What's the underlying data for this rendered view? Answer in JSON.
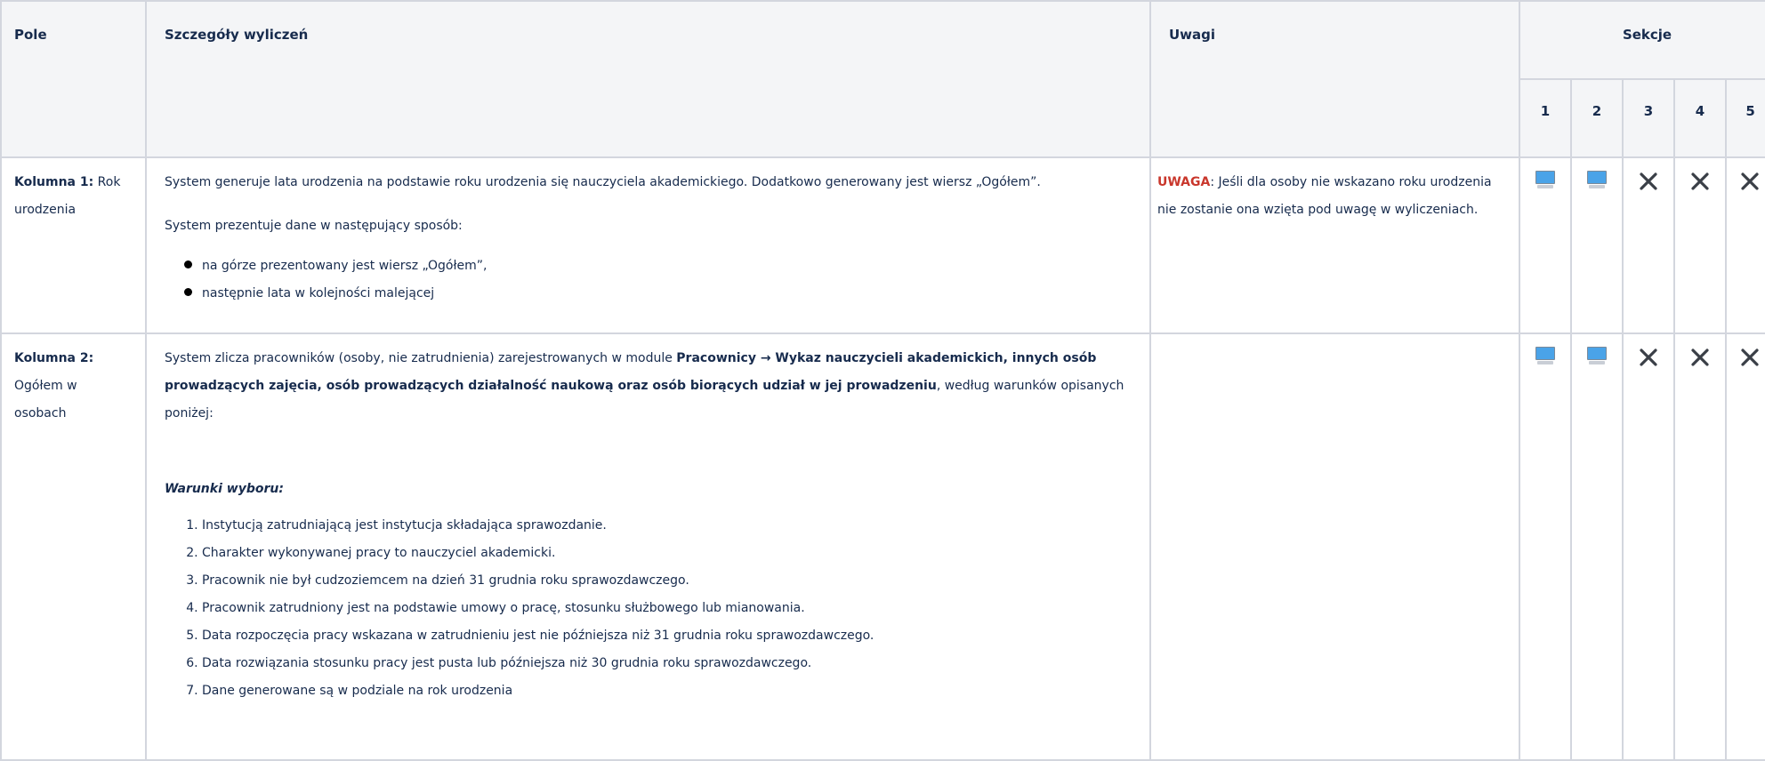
{
  "headers": {
    "pole": "Pole",
    "szczegoly": "Szczegóły wyliczeń",
    "uwagi": "Uwagi",
    "sekcje": "Sekcje",
    "numbers": [
      "1",
      "2",
      "3",
      "4",
      "5"
    ]
  },
  "rows": [
    {
      "pole_bold": "Kolumna 1:",
      "pole_rest": " Rok urodzenia",
      "p1": "System generuje lata urodzenia na podstawie roku urodzenia się nauczyciela akademickiego. Dodatkowo generowany jest wiersz „Ogółem”.",
      "p2": "System prezentuje dane w następujący sposób:",
      "bullets": [
        "na górze prezentowany jest wiersz „Ogółem”,",
        "następnie lata w kolejności malejącej"
      ],
      "uwaga_label": "UWAGA",
      "uwaga_text": ": Jeśli dla osoby nie wskazano roku urodzenia nie zostanie ona wzięta pod uwagę w wyliczeniach.",
      "sections": [
        "monitor-icon",
        "monitor-icon",
        "x-icon",
        "x-icon",
        "x-icon"
      ]
    },
    {
      "pole_bold": "Kolumna 2:",
      "pole_rest": " Ogółem w osobach",
      "p1_a": "System zlicza pracowników (osoby, nie zatrudnienia) zarejestrowanych w module ",
      "p1_b": "Pracownicy → Wykaz nauczycieli akademickich, innych osób prowadzących zajęcia, osób prowadzących działalność naukową oraz osób biorących udział w jej prowadzeniu",
      "p1_c": ", według warunków opisanych poniżej:",
      "cond_title": "Warunki wyboru:",
      "conditions": [
        "Instytucją zatrudniającą jest instytucja składająca sprawozdanie.",
        "Charakter wykonywanej pracy to nauczyciel akademicki.",
        "Pracownik nie był cudzoziemcem na dzień 31 grudnia roku sprawozdawczego.",
        "Pracownik zatrudniony jest na podstawie umowy o pracę, stosunku służbowego lub mianowania.",
        "Data rozpoczęcia pracy wskazana w zatrudnieniu jest nie późniejsza niż 31 grudnia roku sprawozdawczego.",
        "Data rozwiązania stosunku pracy jest pusta lub późniejsza niż 30 grudnia roku sprawozdawczego.",
        "Dane generowane są w podziale na rok urodzenia"
      ],
      "sections": [
        "monitor-icon",
        "monitor-icon",
        "x-icon",
        "x-icon",
        "x-icon"
      ]
    }
  ],
  "colors": {
    "warning": "#c9372c",
    "header_bg": "#f4f5f7",
    "border": "#d3d6de",
    "monitor": "#4aa3e8"
  }
}
